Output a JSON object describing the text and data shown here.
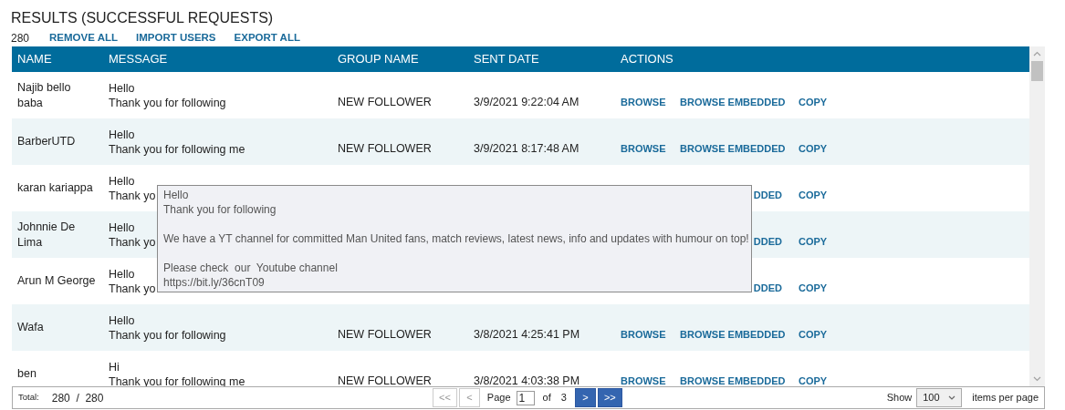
{
  "title": "RESULTS (SUCCESSFUL REQUESTS)",
  "count": "280",
  "toolbar_links": [
    "REMOVE ALL",
    "IMPORT USERS",
    "EXPORT ALL"
  ],
  "table": {
    "columns": [
      "NAME",
      "MESSAGE",
      "GROUP NAME",
      "SENT DATE",
      "ACTIONS"
    ],
    "rows": [
      {
        "name": "Najib bello baba",
        "message": [
          "Hello",
          "Thank you for following"
        ],
        "group": "NEW FOLLOWER",
        "sent_date": "3/9/2021 9:22:04 AM",
        "actions": [
          {
            "kind": "browse",
            "label": "BROWSE"
          },
          {
            "kind": "embedded",
            "label": "BROWSE EMBEDDED"
          },
          {
            "kind": "copy",
            "label": "COPY"
          }
        ]
      },
      {
        "name": "BarberUTD",
        "message": [
          "Hello",
          "Thank you for following me"
        ],
        "group": "NEW FOLLOWER",
        "sent_date": "3/9/2021 8:17:48 AM",
        "actions": [
          {
            "kind": "browse",
            "label": "BROWSE"
          },
          {
            "kind": "embedded",
            "label": "BROWSE EMBEDDED"
          },
          {
            "kind": "copy",
            "label": "COPY"
          }
        ]
      },
      {
        "name": "karan kariappa",
        "message": [
          "Hello",
          "Thank yo"
        ],
        "actions": [
          {
            "kind": "embedded",
            "label": "DDED"
          },
          {
            "kind": "copy",
            "label": "COPY"
          }
        ]
      },
      {
        "name": "Johnnie De Lima",
        "message": [
          "Hello",
          "Thank yo"
        ],
        "actions": [
          {
            "kind": "embedded",
            "label": "DDED"
          },
          {
            "kind": "copy",
            "label": "COPY"
          }
        ]
      },
      {
        "name": "Arun M George",
        "message": [
          "Hello",
          "Thank yo"
        ],
        "actions": [
          {
            "kind": "embedded",
            "label": "DDED"
          },
          {
            "kind": "copy",
            "label": "COPY"
          }
        ]
      },
      {
        "name": "Wafa",
        "message": [
          "Hello",
          "Thank you for following"
        ],
        "group": "NEW FOLLOWER",
        "sent_date": "3/8/2021 4:25:41 PM",
        "actions": [
          {
            "kind": "browse",
            "label": "BROWSE"
          },
          {
            "kind": "embedded",
            "label": "BROWSE EMBEDDED"
          },
          {
            "kind": "copy",
            "label": "COPY"
          }
        ]
      },
      {
        "name": "ben",
        "message": [
          "Hi",
          "Thank you for following me"
        ],
        "group": "NEW FOLLOWER",
        "sent_date": "3/8/2021 4:03:38 PM",
        "actions": [
          {
            "kind": "browse",
            "label": "BROWSE"
          },
          {
            "kind": "embedded",
            "label": "BROWSE EMBEDDED"
          },
          {
            "kind": "copy",
            "label": "COPY"
          }
        ]
      }
    ]
  },
  "tooltip": {
    "paragraphs": [
      [
        "Hello",
        "Thank you for following"
      ],
      [
        "We have a YT channel for committed Man United fans, match reviews, latest news, info and updates with humour on top!"
      ],
      [
        "Please check  our  Youtube channel",
        "https://bit.ly/36cnT09"
      ]
    ]
  },
  "pager": {
    "total_label": "Total:",
    "total": "280  /  280",
    "buttons": [
      {
        "label": "<<",
        "disabled": true
      },
      {
        "label": "<",
        "disabled": true
      }
    ],
    "page_label": "Page",
    "page": "1",
    "of_label": "of",
    "pages": "3",
    "next_buttons": [
      {
        "label": ">",
        "disabled": false
      },
      {
        "label": ">>",
        "disabled": false
      }
    ],
    "show_label": "Show",
    "page_size": "100",
    "per_page_label": "items per page"
  }
}
